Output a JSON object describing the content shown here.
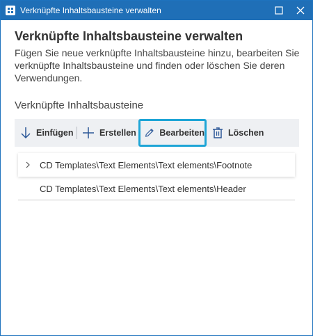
{
  "window": {
    "title": "Verknüpfte Inhaltsbausteine verwalten"
  },
  "heading": "Verknüpfte Inhaltsbausteine verwalten",
  "description": "Fügen Sie neue verknüpfte Inhaltsbausteine hinzu, bearbeiten Sie verknüpfte Inhaltsbausteine und finden oder löschen Sie deren Verwendungen.",
  "section_label": "Verknüpfte Inhaltsbausteine",
  "toolbar": {
    "insert_label": "Einfügen",
    "create_label": "Erstellen",
    "edit_label": "Bearbeiten",
    "delete_label": "Löschen"
  },
  "items": [
    {
      "path": "CD Templates\\Text Elements\\Text elements\\Footnote",
      "expandable": true,
      "selected": true
    },
    {
      "path": "CD Templates\\Text Elements\\Text elements\\Header",
      "expandable": false,
      "selected": false
    }
  ],
  "colors": {
    "titlebar": "#1f6fb7",
    "toolbar_bg": "#eef0f3",
    "highlight_border": "#1ea5d6"
  }
}
